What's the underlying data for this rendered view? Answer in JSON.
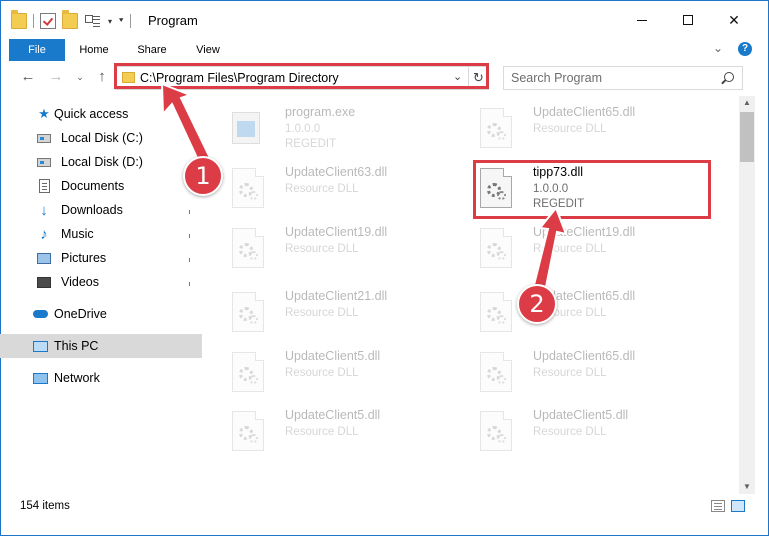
{
  "window": {
    "title": "Program",
    "close_glyph": "✕"
  },
  "ribbon": {
    "tabs": [
      {
        "label": "File"
      },
      {
        "label": "Home"
      },
      {
        "label": "Share"
      },
      {
        "label": "View"
      }
    ],
    "help_glyph": "?"
  },
  "navigation": {
    "address": "C:\\Program Files\\Program Directory",
    "search_placeholder": "Search Program"
  },
  "sidebar": {
    "items": [
      {
        "label": "Quick access",
        "icon": "star-icon"
      },
      {
        "label": "Local Disk (C:)",
        "icon": "disk-icon"
      },
      {
        "label": "Local Disk (D:)",
        "icon": "disk-icon"
      },
      {
        "label": "Documents",
        "icon": "documents-icon"
      },
      {
        "label": "Downloads",
        "icon": "downloads-icon"
      },
      {
        "label": "Music",
        "icon": "music-icon"
      },
      {
        "label": "Pictures",
        "icon": "pictures-icon"
      },
      {
        "label": "Videos",
        "icon": "videos-icon"
      },
      {
        "label": "OneDrive",
        "icon": "cloud-icon"
      },
      {
        "label": "This PC",
        "icon": "computer-icon",
        "selected": true
      },
      {
        "label": "Network",
        "icon": "network-icon"
      }
    ]
  },
  "files": [
    {
      "name": "program.exe",
      "line2": "1.0.0.0",
      "line3": "REGEDIT",
      "type": "exe"
    },
    {
      "name": "UpdateClient65.dll",
      "line2": "Resource DLL",
      "line3": "",
      "type": "dll"
    },
    {
      "name": "UpdateClient63.dll",
      "line2": "Resource DLL",
      "line3": "",
      "type": "dll"
    },
    {
      "name": "tipp73.dll",
      "line2": "1.0.0.0",
      "line3": "REGEDIT",
      "type": "dll",
      "highlighted": true
    },
    {
      "name": "UpdateClient19.dll",
      "line2": "Resource DLL",
      "line3": "",
      "type": "dll"
    },
    {
      "name": "UpdateClient19.dll",
      "line2": "Resource DLL",
      "line3": "",
      "type": "dll"
    },
    {
      "name": "UpdateClient21.dll",
      "line2": "Resource DLL",
      "line3": "",
      "type": "dll"
    },
    {
      "name": "UpdateClient65.dll",
      "line2": "Resource DLL",
      "line3": "",
      "type": "dll"
    },
    {
      "name": "UpdateClient5.dll",
      "line2": "Resource DLL",
      "line3": "",
      "type": "dll"
    },
    {
      "name": "UpdateClient65.dll",
      "line2": "Resource DLL",
      "line3": "",
      "type": "dll"
    },
    {
      "name": "UpdateClient5.dll",
      "line2": "Resource DLL",
      "line3": "",
      "type": "dll"
    },
    {
      "name": "UpdateClient5.dll",
      "line2": "Resource DLL",
      "line3": "",
      "type": "dll"
    }
  ],
  "status": {
    "item_count": "154 items"
  },
  "annotations": {
    "step1": "1",
    "step2": "2",
    "color": "#dc3c46"
  }
}
